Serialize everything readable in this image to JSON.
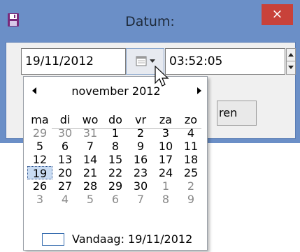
{
  "window": {
    "title": "Datum:",
    "close_label": "×"
  },
  "date_field": {
    "value": "19/11/2012"
  },
  "time_field": {
    "value": "03:52:05"
  },
  "background_button": {
    "label": "ren"
  },
  "calendar": {
    "month_label": "november 2012",
    "weekdays": [
      "ma",
      "di",
      "wo",
      "do",
      "vr",
      "za",
      "zo"
    ],
    "weeks": [
      [
        "29",
        "30",
        "31",
        "1",
        "2",
        "3",
        "4"
      ],
      [
        "5",
        "6",
        "7",
        "8",
        "9",
        "10",
        "11"
      ],
      [
        "12",
        "13",
        "14",
        "15",
        "16",
        "17",
        "18"
      ],
      [
        "19",
        "20",
        "21",
        "22",
        "23",
        "24",
        "25"
      ],
      [
        "26",
        "27",
        "28",
        "29",
        "30",
        "1",
        "2"
      ],
      [
        "3",
        "4",
        "5",
        "6",
        "7",
        "8",
        "9"
      ]
    ],
    "today_label": "Vandaag: 19/11/2012"
  },
  "colors": {
    "window_frame": "#6b8fc7",
    "close_button": "#c8423a",
    "selected_day": "#c9dcf3"
  },
  "icons": [
    "save-disk-icon",
    "close-icon",
    "calendar-dropdown-icon",
    "prev-month-icon",
    "next-month-icon",
    "mouse-cursor-icon"
  ]
}
